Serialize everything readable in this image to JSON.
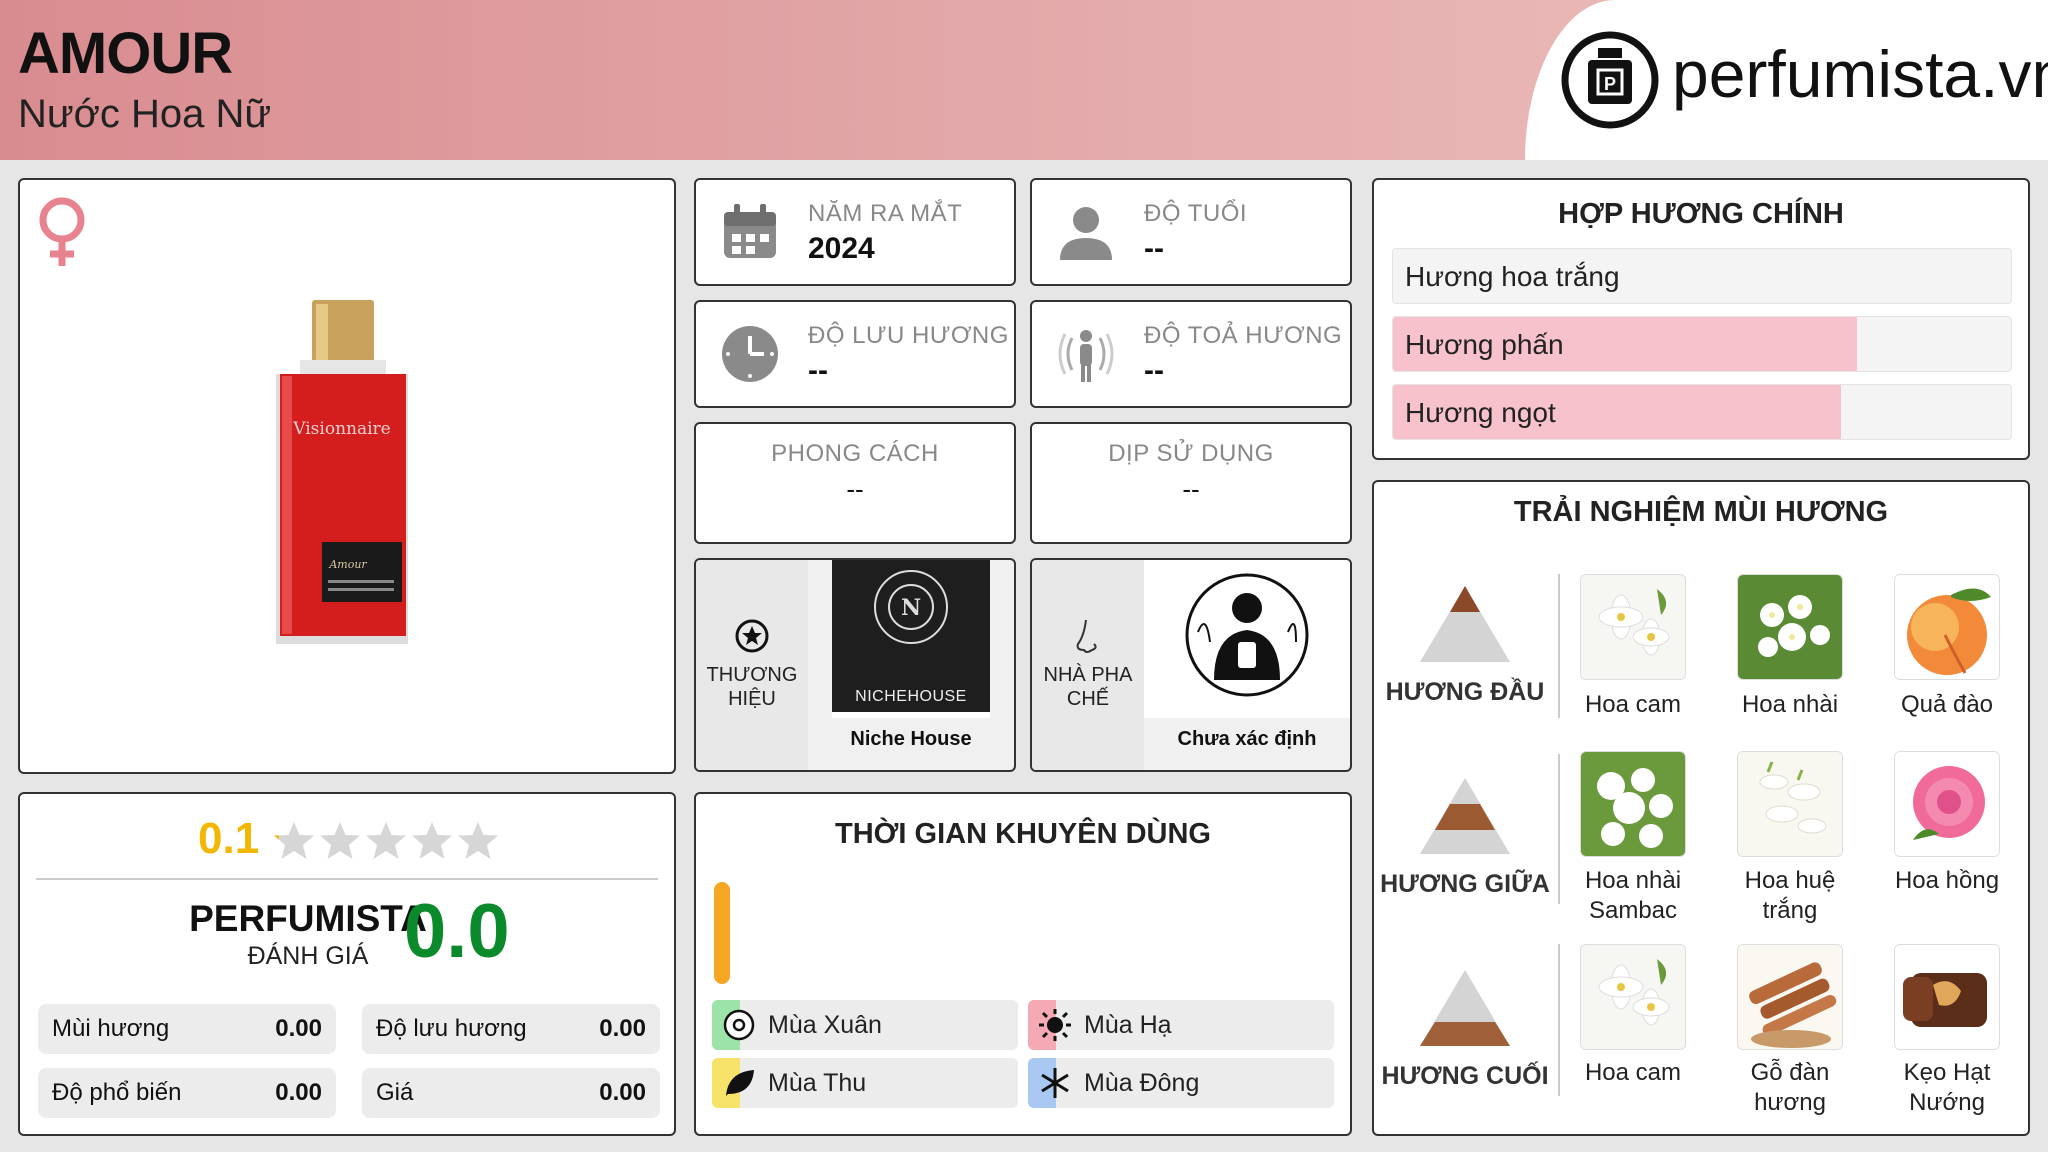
{
  "header": {
    "title": "AMOUR",
    "subtitle": "Nước Hoa Nữ",
    "logo_text": "perfumista.vn"
  },
  "product": {
    "bottle_label": "Visionnaire",
    "bottle_plate": "Amour"
  },
  "stats": {
    "release_year": {
      "label": "NĂM RA MẮT",
      "value": "2024"
    },
    "age": {
      "label": "ĐỘ TUỔI",
      "value": "--"
    },
    "longevity": {
      "label": "ĐỘ LƯU HƯƠNG",
      "value": "--"
    },
    "sillage": {
      "label": "ĐỘ TOẢ HƯƠNG",
      "value": "--"
    },
    "style": {
      "label": "PHONG CÁCH",
      "value": "--"
    },
    "occasion": {
      "label": "DỊP SỬ DỤNG",
      "value": "--"
    }
  },
  "brand": {
    "label_line1": "THƯƠNG",
    "label_line2": "HIỆU",
    "logo_top_text": "NICHEHOUSE",
    "logo_word": "NICHEHOUSE",
    "name": "Niche House"
  },
  "perfumer": {
    "label_line1": "NHÀ PHA",
    "label_line2": "CHẾ",
    "name": "Chưa xác định"
  },
  "rating": {
    "user_score": "0.1",
    "stars_total": 5,
    "stars_filled": 0.02,
    "perfumista_label": "PERFUMISTA",
    "perfumista_sub": "ĐÁNH GIÁ",
    "perfumista_score": "0.0",
    "rows": [
      {
        "label": "Mùi hương",
        "value": "0.00"
      },
      {
        "label": "Độ lưu hương",
        "value": "0.00"
      },
      {
        "label": "Độ phổ biến",
        "value": "0.00"
      },
      {
        "label": "Giá",
        "value": "0.00"
      }
    ]
  },
  "usage": {
    "title": "THỜI GIAN KHUYÊN DÙNG",
    "bar_color": "#f5a623",
    "seasons": [
      {
        "label": "Mùa Xuân",
        "color": "#9be3a6"
      },
      {
        "label": "Mùa Hạ",
        "color": "#f4a9b4"
      },
      {
        "label": "Mùa Thu",
        "color": "#f7e36a"
      },
      {
        "label": "Mùa Đông",
        "color": "#a9c9f2"
      }
    ]
  },
  "accords": {
    "title": "HỢP HƯƠNG CHÍNH",
    "fill_color": "#f7c2cc",
    "items": [
      {
        "label": "Hương hoa trắng",
        "level": 0
      },
      {
        "label": "Hương phấn",
        "level": 0.75
      },
      {
        "label": "Hương ngọt",
        "level": 0.725
      }
    ]
  },
  "notes": {
    "title": "TRẢI NGHIỆM MÙI HƯƠNG",
    "top": {
      "label": "HƯƠNG ĐẦU",
      "items": [
        "Hoa cam",
        "Hoa nhài",
        "Quả đào"
      ]
    },
    "middle": {
      "label": "HƯƠNG GIỮA",
      "items": [
        "Hoa nhài Sambac",
        "Hoa huệ trắng",
        "Hoa hồng"
      ]
    },
    "base": {
      "label": "HƯƠNG CUỐI",
      "items": [
        "Hoa cam",
        "Gỗ đàn hương",
        "Kẹo Hạt Nướng"
      ]
    }
  }
}
